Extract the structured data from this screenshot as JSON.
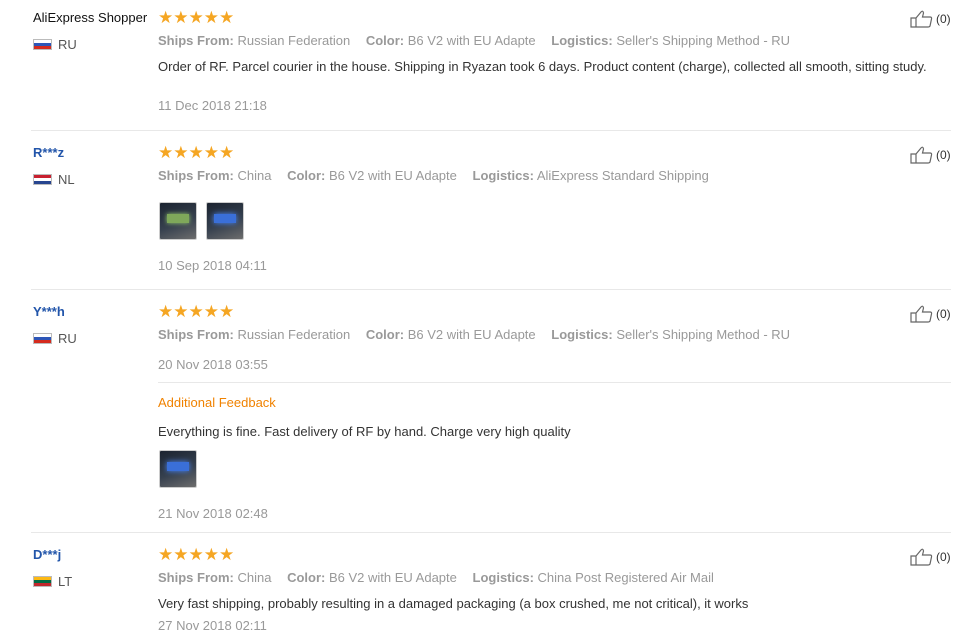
{
  "labels": {
    "ships_from": "Ships From:",
    "color": "Color:",
    "logistics": "Logistics:",
    "additional_feedback": "Additional Feedback"
  },
  "stars_text": "★★★★★",
  "reviews": [
    {
      "buyer": "AliExpress Shopper",
      "country": "RU",
      "rating": 5,
      "ships_from": "Russian Federation",
      "color": "B6 V2 with EU Adapte",
      "logistics": "Seller's Shipping Method - RU",
      "text": "Order of RF. Parcel courier in the house. Shipping in Ryazan took 6 days. Product content (charge), collected all smooth, sitting study.",
      "date": "11 Dec 2018 21:18",
      "likes": "(0)"
    },
    {
      "buyer": "R***z",
      "country": "NL",
      "rating": 5,
      "ships_from": "China",
      "color": "B6 V2 with EU Adapte",
      "logistics": "AliExpress Standard Shipping",
      "date": "10 Sep 2018 04:11",
      "likes": "(0)"
    },
    {
      "buyer": "Y***h",
      "country": "RU",
      "rating": 5,
      "ships_from": "Russian Federation",
      "color": "B6 V2 with EU Adapte",
      "logistics": "Seller's Shipping Method - RU",
      "date": "20 Nov 2018 03:55",
      "additional_text": "Everything is fine. Fast delivery of RF by hand. Charge very high quality",
      "additional_date": "21 Nov 2018 02:48",
      "likes": "(0)"
    },
    {
      "buyer": "D***j",
      "country": "LT",
      "rating": 5,
      "ships_from": "China",
      "color": "B6 V2 with EU Adapte",
      "logistics": "China Post Registered Air Mail",
      "text": "Very fast shipping, probably resulting in a damaged packaging (a box crushed, me not critical), it works",
      "date": "27 Nov 2018 02:11",
      "likes": "(0)"
    }
  ]
}
